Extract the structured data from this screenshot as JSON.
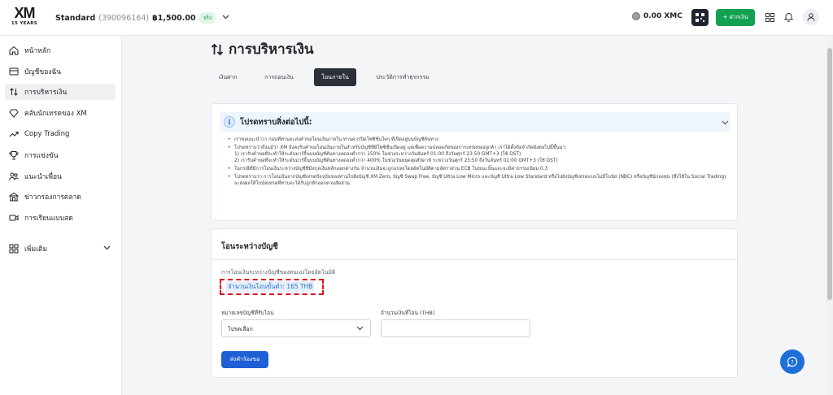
{
  "header": {
    "logo_text": "XM",
    "logo_subtext": "15 YEARS",
    "account_type": "Standard",
    "account_number": "(390096164)",
    "balance": "฿1,500.00",
    "account_badge": "จริง",
    "xmc_balance": "0.00 XMC",
    "deposit_label": "+ ฝากเงิน"
  },
  "sidebar": {
    "items": [
      {
        "label": "หน้าหลัก",
        "icon": "home-icon"
      },
      {
        "label": "บัญชีของฉัน",
        "icon": "wallet-icon"
      },
      {
        "label": "การบริหารเงิน",
        "icon": "transfer-arrows-icon"
      },
      {
        "label": "คลับนักเทรดของ XM",
        "icon": "diamond-icon"
      },
      {
        "label": "Copy Trading",
        "icon": "trend-icon"
      },
      {
        "label": "การแข่งขัน",
        "icon": "trophy-icon"
      },
      {
        "label": "แนะนำเพื่อน",
        "icon": "people-icon"
      },
      {
        "label": "ข่าวกรองการตลาด",
        "icon": "news-icon"
      },
      {
        "label": "การเรียนแบบสด",
        "icon": "video-icon"
      }
    ],
    "more_label": "เพิ่มเติม"
  },
  "main": {
    "title": "การบริหารเงิน",
    "tabs": [
      "เงินฝาก",
      "การถอนเงิน",
      "โอนภายใน",
      "ประวัติการทำธุรกรรม"
    ],
    "active_tab": "โอนภายใน",
    "notice": {
      "title": "โปรดทราบสิ่งต่อไปนี้:",
      "items": [
        "เราขอแนะนำว่า ก่อนที่ท่านจะส่งคำขอโอนเงินภายใน ท่านควรปิดโพซิชั่นใดๆ ที่เปิดอยู่บนบัญชีต้นทาง",
        "โปรดทราบว่าถึงแม้ว่า XM ยังคงรับคำขอโอนเงินภายในสำหรับบัญชีที่มีโพซิชั่นเปิดอยู่ แต่เพื่อความปลอดภัยของการเทรดของลูกค้า เราได้ตั้งข้อจำกัดดังต่อไปนี้ขึ้นมา:",
        "ในกรณีที่มีการโอนเงินระหว่างบัญชีที่มีสกุลเงินหลักแตกต่างกัน จำนวนเงินจะถูกแปลงโดยอัตโนมัติตามอัตราส่วน ECB ในขณะนั้นและจะมีค่าธรรมเนียม 0.3",
        "โปรดทราบว่า การโอนเงินจากบัญชีเทรดปัจจุบันของท่านไปยังบัญชี XM Zero, บัญชี Swap Free, บัญชี Ultra Low Micro และบัญชี Ultra Low Standard หรือไปยังบัญชีเทรดแบบไม่มีโบนัส (NBC) หรือบัญชีนักลงทุน (ซึ่งใช้ใน Social Trading) จะส่งผลให้โบนัสเทรดที่ท่านจะได้รับถูกหักออกตามสัดส่วน"
      ],
      "sub_items": [
        "1) เรารับคำขอที่จะทำให้ระดับมาร์จิ้นบนบัญชีต้นทางลดลงต่ำกว่า 150% ในช่วงระหว่างวันจันทร์ 01:00 ถึงวันศุกร์ 23:50 GMT+3 (ใช้ DST)",
        "2) เรารับคำขอที่จะทำให้ระดับมาร์จิ้นบนบัญชีต้นทางลดลงต่ำกว่า 400% ในช่วงวันหยุดสุดสัปดาห์ ระหว่างวันศุกร์ 23:50 ถึงวันจันทร์ 01:00 GMT+3 (ใช้ DST)"
      ]
    },
    "transfer": {
      "title": "โอนระหว่างบัญชี",
      "description": "การโอนเงินระหว่างบัญชีของตนเองโดยอัตโนมัติ",
      "minimum": "จำนวนเงินโอนขั้นต่ำ: 165 THB",
      "account_label": "หมายเลขบัญชีที่รับโอน",
      "account_placeholder": "โปรดเลือก",
      "amount_label": "จำนวนเงินที่โอน (THB)",
      "amount_value": "",
      "submit_label": "ส่งคำร้องขอ"
    }
  },
  "colors": {
    "brand_green": "#12a150",
    "primary_blue": "#1e5fd6",
    "highlight_red": "#e0101a"
  }
}
